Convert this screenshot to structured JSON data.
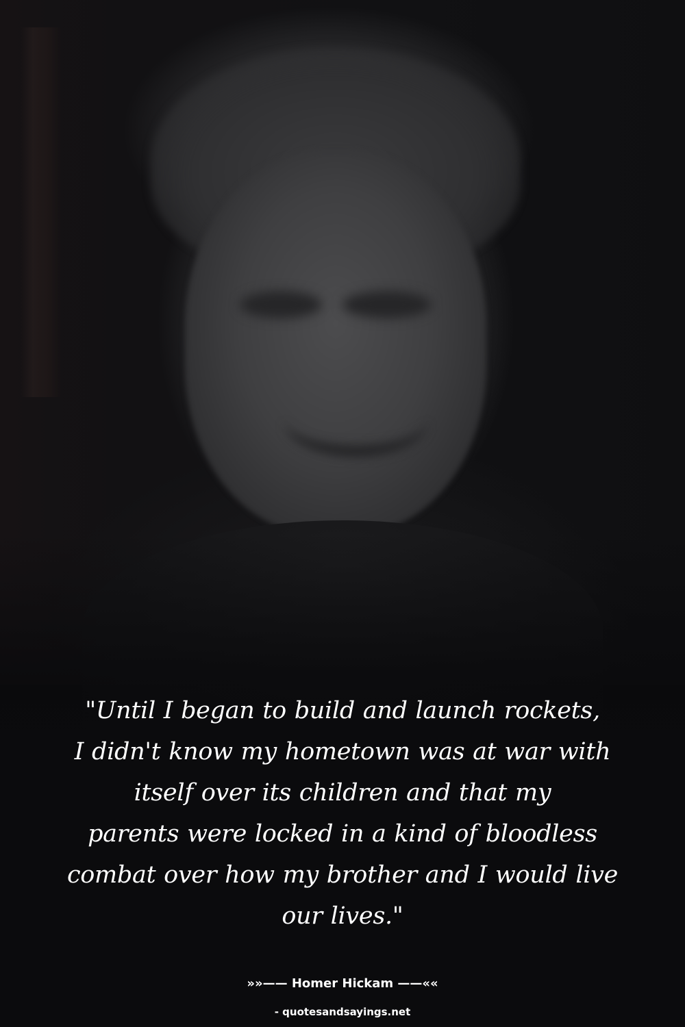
{
  "quote": {
    "lines": [
      "\"Until I began to build and launch rockets,",
      "I didn't know my hometown was at war with",
      "itself over its children and that my",
      "parents were locked in a kind of bloodless",
      "combat over how my brother and I would live",
      "our lives.\""
    ]
  },
  "author": "»»—— Homer Hickam ——««",
  "source": "- quotesandsayings.net",
  "colors": {
    "background": "#0c0c0e",
    "text": "#ffffff"
  }
}
